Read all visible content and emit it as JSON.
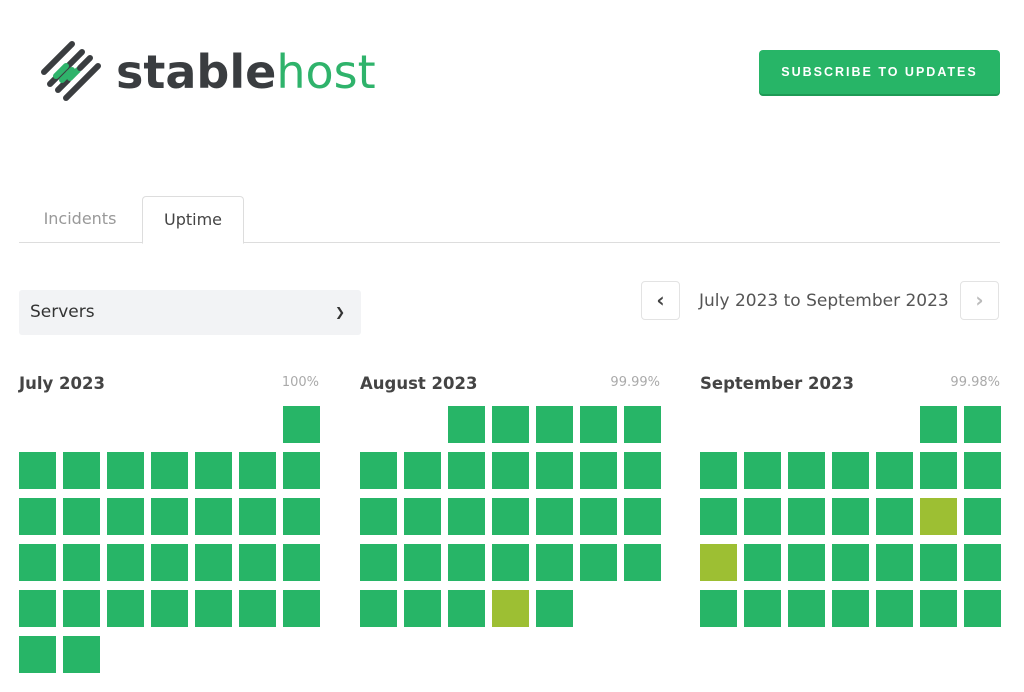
{
  "logo": {
    "part1": "stable",
    "part2": "host"
  },
  "header": {
    "subscribe_label": "SUBSCRIBE TO UPDATES"
  },
  "tabs": [
    {
      "label": "Incidents",
      "active": false
    },
    {
      "label": "Uptime",
      "active": true
    }
  ],
  "filter": {
    "selected": "Servers"
  },
  "range": {
    "label": "July 2023 to September 2023"
  },
  "colors": {
    "operational": "#27b567",
    "degraded": "#9dbf33",
    "brand": "#27b567"
  },
  "months": [
    {
      "name": "July 2023",
      "uptime": "100%",
      "year": 2023,
      "month": 7,
      "days": 31,
      "degraded_days": []
    },
    {
      "name": "August 2023",
      "uptime": "99.99%",
      "year": 2023,
      "month": 8,
      "days": 31,
      "degraded_days": [
        30
      ]
    },
    {
      "name": "September 2023",
      "uptime": "99.98%",
      "year": 2023,
      "month": 9,
      "days": 30,
      "degraded_days": [
        15,
        17
      ]
    }
  ]
}
